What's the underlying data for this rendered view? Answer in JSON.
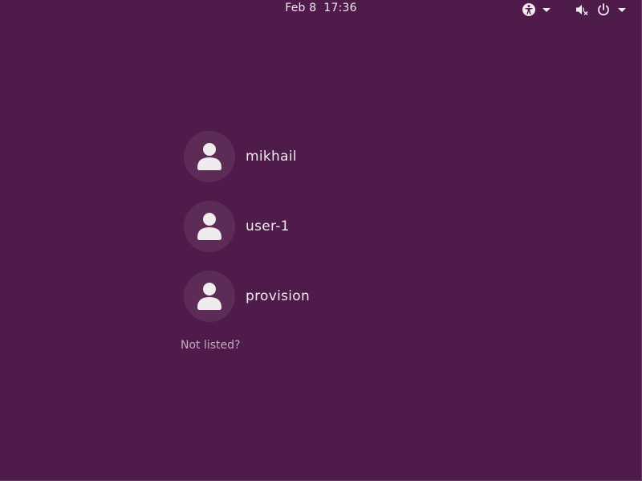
{
  "top_bar": {
    "date": "Feb 8",
    "time": "17:36",
    "icons": [
      "accessibility-icon",
      "volume-muted-icon",
      "power-icon"
    ]
  },
  "users": [
    {
      "name": "mikhail"
    },
    {
      "name": "user-1"
    },
    {
      "name": "provision"
    }
  ],
  "not_listed_label": "Not listed?",
  "colors": {
    "background": "#4f1b4a",
    "avatar_bg": "#5c2c57",
    "text": "#f0ebee",
    "muted_text": "#bfaebc"
  }
}
